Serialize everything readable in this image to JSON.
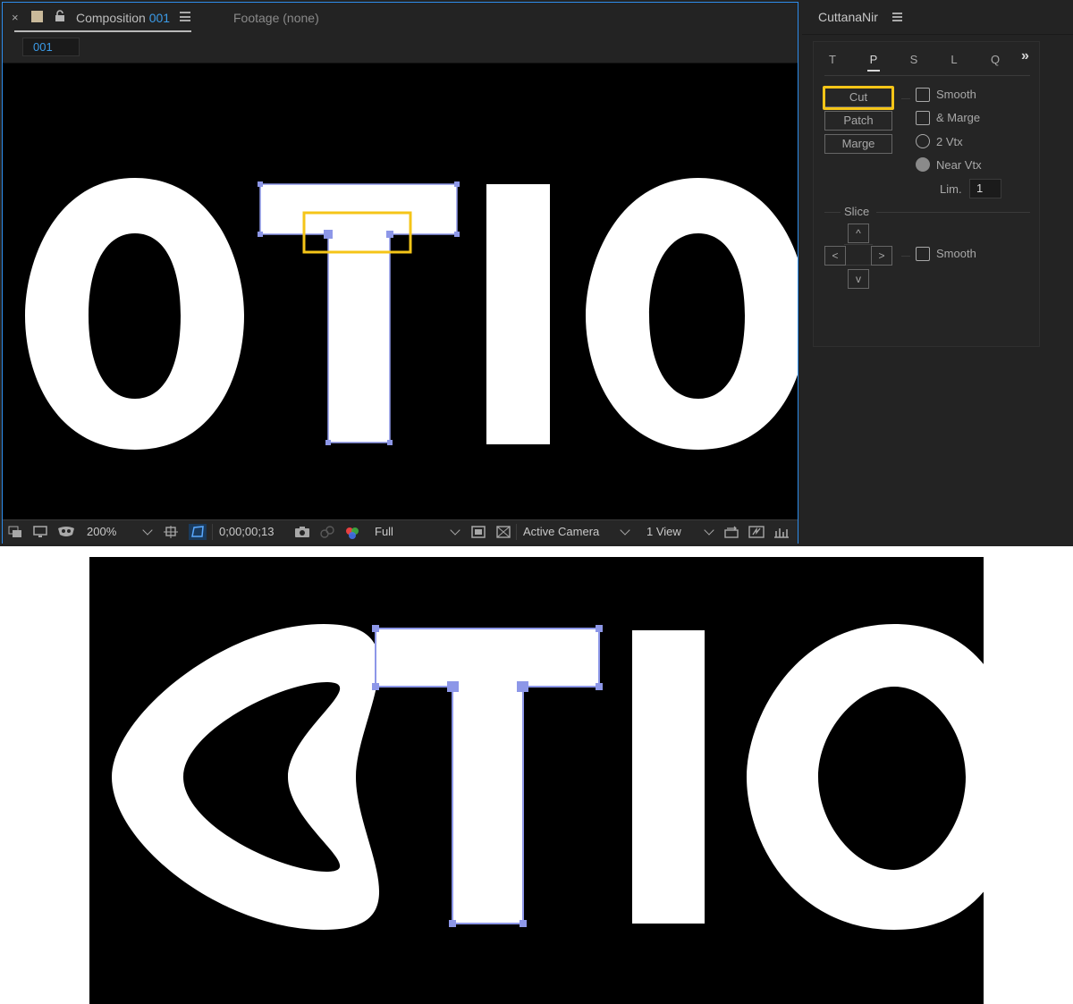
{
  "composition_panel": {
    "close_icon": "close-icon",
    "tab_label": "Composition",
    "tab_number": "001",
    "footage_label": "Footage",
    "footage_value": "(none)",
    "subtab": "001"
  },
  "viewer": {
    "letters": [
      "O",
      "T",
      "I",
      "O"
    ],
    "path_color": "#8d97e8",
    "highlight_color": "#f5c518"
  },
  "toolbar": {
    "zoom": "200%",
    "timecode": "0;00;00;13",
    "resolution": "Full",
    "camera": "Active Camera",
    "views": "1 View"
  },
  "plugin": {
    "title": "CuttanaNir",
    "tabs": [
      "T",
      "P",
      "S",
      "L",
      "Q"
    ],
    "active_tab": "P",
    "more": "»",
    "buttons": {
      "cut": "Cut",
      "patch": "Patch",
      "marge": "Marge"
    },
    "options": {
      "smooth": "Smooth",
      "and_marge": "& Marge",
      "two_vtx": "2 Vtx",
      "near_vtx": "Near Vtx"
    },
    "lim_label": "Lim.",
    "lim_value": "1",
    "slice_label": "Slice",
    "arrows": {
      "up": "^",
      "left": "<",
      "right": ">",
      "down": "v"
    },
    "slice_smooth": "Smooth"
  },
  "zoom_view": {
    "letters": [
      "O",
      "T",
      "I",
      "O"
    ]
  }
}
